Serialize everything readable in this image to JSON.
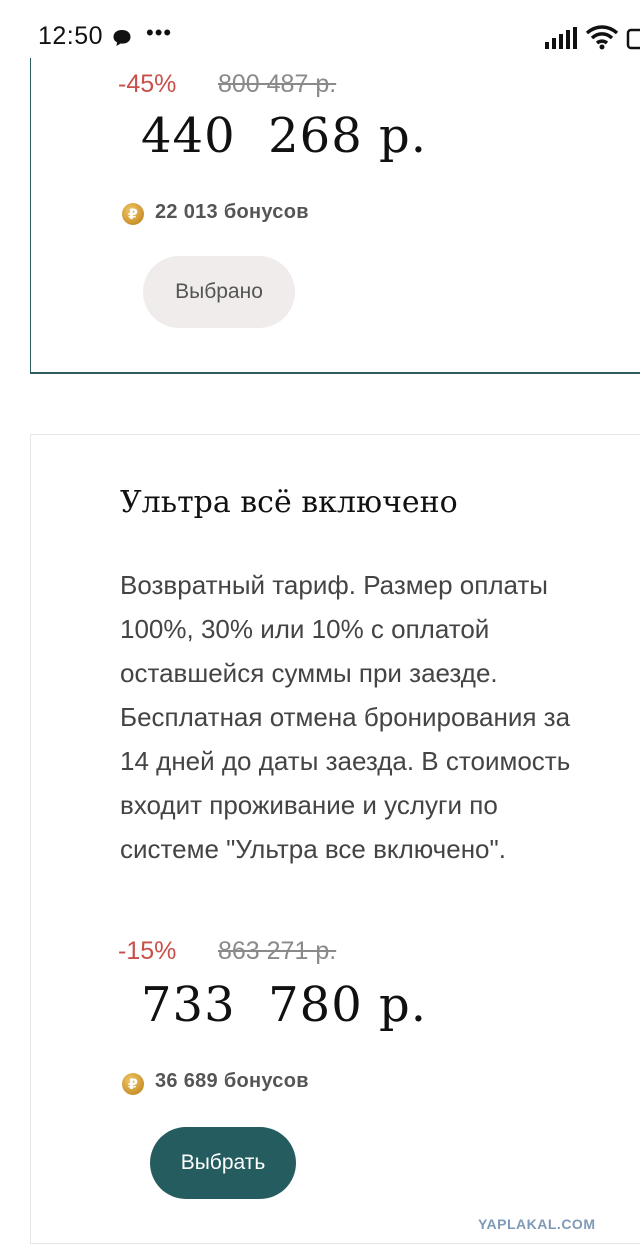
{
  "status_bar": {
    "time": "12:50",
    "dots": "•••",
    "icons": [
      "chat-bubble-icon",
      "signal-icon",
      "wifi-icon",
      "battery-icon"
    ]
  },
  "tariff_top": {
    "discount": "-45%",
    "old_price": "800 487 р.",
    "price": "440  268 р.",
    "bonus": "22 013 бонусов",
    "bonus_icon": "ruble-coin-icon",
    "button_label": "Выбрано"
  },
  "tariff_ultra": {
    "title": "Ультра всё включено",
    "description": "Возвратный тариф. Размер оплаты 100%, 30% или 10% с оплатой оставшейся суммы при заезде. Бесплатная отмена бронирования за 14 дней до даты заезда. В стоимость входит проживание и услуги по системе \"Ультра все включено\".",
    "discount": "-15%",
    "old_price": "863 271 р.",
    "price": "733  780 р.",
    "bonus": "36 689 бонусов",
    "bonus_icon": "ruble-coin-icon",
    "button_label": "Выбрать"
  },
  "watermark": "YAPLAKAL.COM",
  "colors": {
    "accent": "#255c60",
    "discount": "#c8504a",
    "selected_button_bg": "#efeceb"
  }
}
